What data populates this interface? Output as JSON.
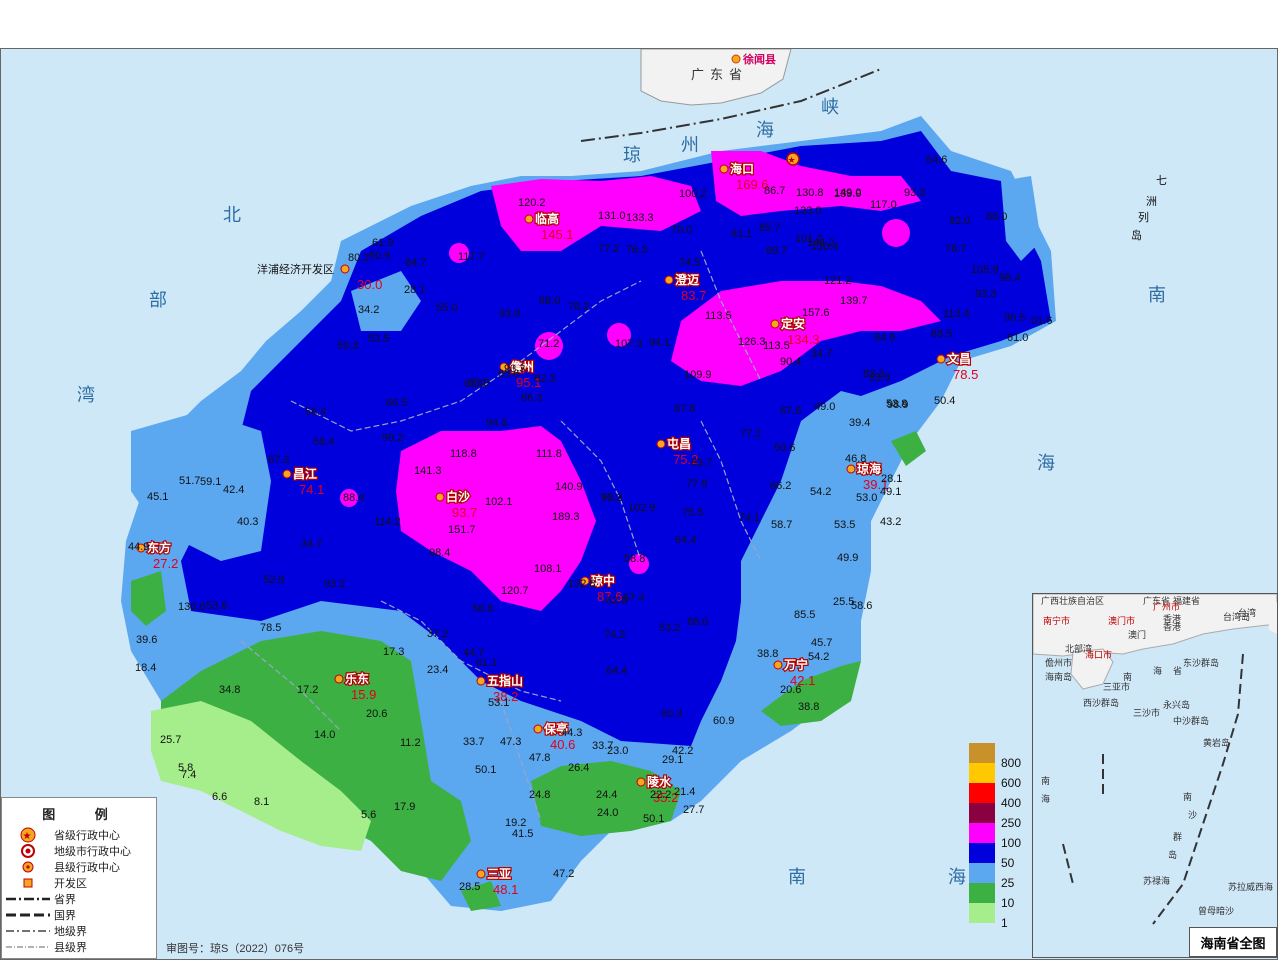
{
  "regions": [
    {
      "name": "广东省"
    },
    {
      "name": "徐闻县"
    }
  ],
  "sea_labels": [
    "琼",
    "州",
    "海",
    "峡",
    "北",
    "部",
    "湾",
    "南",
    "海",
    "七",
    "洲",
    "列",
    "岛",
    "南",
    "海"
  ],
  "cities": [
    {
      "name": "海口",
      "value": "169.6"
    },
    {
      "name": "临高",
      "value": "145.1"
    },
    {
      "name": "澄迈",
      "value": "83.7"
    },
    {
      "name": "定安",
      "value": "134.3"
    },
    {
      "name": "文昌",
      "value": "78.5"
    },
    {
      "name": "儋州",
      "value": "95.1"
    },
    {
      "name": "屯昌",
      "value": "75.2"
    },
    {
      "name": "琼海",
      "value": "39.1"
    },
    {
      "name": "昌江",
      "value": "74.1"
    },
    {
      "name": "白沙",
      "value": "93.7"
    },
    {
      "name": "东方",
      "value": "27.2"
    },
    {
      "name": "琼中",
      "value": "87.6"
    },
    {
      "name": "万宁",
      "value": "42.1"
    },
    {
      "name": "乐东",
      "value": "15.9"
    },
    {
      "name": "五指山",
      "value": "38.2"
    },
    {
      "name": "保亭",
      "value": "40.6"
    },
    {
      "name": "陵水",
      "value": "35.2"
    },
    {
      "name": "三亚",
      "value": "48.1"
    },
    {
      "name": "洋浦经济开发区",
      "value": "30.0"
    }
  ],
  "stations": [
    "93.3",
    "64.6",
    "82.0",
    "66.0",
    "76.7",
    "105.9",
    "98.4",
    "93.3",
    "90.5",
    "01.6",
    "61.0",
    "113.4",
    "88.5",
    "98.9",
    "63.9",
    "84.9",
    "139.7",
    "157.6",
    "113.5",
    "126.3",
    "113.5",
    "90.4",
    "34.7",
    "83.3",
    "53.8",
    "50.4",
    "49.0",
    "39.4",
    "67.6",
    "77.2",
    "50.6",
    "46.8",
    "28.1",
    "53.0",
    "49.1",
    "54.2",
    "53.5",
    "43.2",
    "49.9",
    "58.7",
    "74.1",
    "66.2",
    "75.5",
    "102.9",
    "77.9",
    "83.7",
    "87.8",
    "94.1",
    "107.3",
    "109.9",
    "189.3",
    "140.9",
    "108.1",
    "132.8",
    "120.7",
    "98.4",
    "151.7",
    "102.1",
    "141.3",
    "118.8",
    "111.8",
    "94.6",
    "93.3",
    "86.3",
    "82.3",
    "93.9",
    "66.5",
    "99.2",
    "56.4",
    "58.4",
    "67.3",
    "59.3",
    "53.5",
    "61.9",
    "55.0",
    "34.2",
    "84.7",
    "90.9",
    "28.1",
    "80.2",
    "117.7",
    "120.2",
    "131.0",
    "133.3",
    "77.2",
    "76.3",
    "70.0",
    "81.1",
    "89.7",
    "85.7",
    "86.7",
    "101.2",
    "130.4",
    "133.0",
    "130.8",
    "139.9",
    "149.0",
    "117.0",
    "100.2",
    "144.2",
    "121.2",
    "71.2",
    "88.0",
    "78.2",
    "74.5",
    "93.9",
    "62.0",
    "65.6",
    "52.8",
    "51.7",
    "59.1",
    "42.4",
    "45.1",
    "44.9",
    "40.3",
    "34.7",
    "93.2",
    "88.4",
    "114.2",
    "136.6",
    "53.6",
    "78.5",
    "39.6",
    "18.4",
    "34.8",
    "17.2",
    "20.6",
    "14.0",
    "11.2",
    "25.7",
    "5.8",
    "7.4",
    "6.6",
    "8.1",
    "5.6",
    "17.9",
    "17.3",
    "23.4",
    "37.2",
    "44.7",
    "61.1",
    "53.1",
    "33.7",
    "47.3",
    "50.1",
    "44.3",
    "47.8",
    "33.7",
    "23.0",
    "26.4",
    "24.8",
    "24.4",
    "24.0",
    "19.2",
    "41.5",
    "28.5",
    "47.2",
    "50.1",
    "27.7",
    "22.2",
    "21.4",
    "29.1",
    "42.2",
    "60.9",
    "38.8",
    "20.6",
    "45.7",
    "54.2",
    "38.8",
    "85.5",
    "58.6",
    "25.5",
    "64.4",
    "74.3",
    "58.8",
    "53.2",
    "88.6",
    "62.0",
    "67.4",
    "60.3",
    "58.8",
    "64.4",
    "90.3",
    "77.2"
  ],
  "legend": {
    "title": "图 例",
    "items": [
      {
        "label": "省级行政中心"
      },
      {
        "label": "地级市行政中心"
      },
      {
        "label": "县级行政中心"
      },
      {
        "label": "开发区"
      },
      {
        "label": "省界"
      },
      {
        "label": "国界"
      },
      {
        "label": "地级界"
      },
      {
        "label": "县级界"
      }
    ]
  },
  "scale": [
    {
      "color": "#c8912a",
      "label": "800"
    },
    {
      "color": "#ffc800",
      "label": "600"
    },
    {
      "color": "#ff0000",
      "label": "400"
    },
    {
      "color": "#8b0040",
      "label": "250"
    },
    {
      "color": "#ff00ff",
      "label": "100"
    },
    {
      "color": "#0000dd",
      "label": "50"
    },
    {
      "color": "#5ba8f0",
      "label": "25"
    },
    {
      "color": "#3cb043",
      "label": "10"
    },
    {
      "color": "#a6ee8c",
      "label": "1"
    }
  ],
  "approval": "审图号：琼S（2022）076号",
  "inset": {
    "title": "海南省全图",
    "labels": [
      "广西壮族自治区",
      "广东省",
      "福建省",
      "台湾",
      "南宁市",
      "广州市",
      "澳门市",
      "香港",
      "澳门",
      "香港",
      "台湾岛",
      "北部湾",
      "海口市",
      "儋州市",
      "海南岛",
      "三亚市",
      "南",
      "海",
      "省",
      "东沙群岛",
      "西沙群岛",
      "永兴岛",
      "三沙市",
      "中沙群岛",
      "黄岩岛",
      "南",
      "海",
      "南",
      "沙",
      "群",
      "岛",
      "苏禄海",
      "苏拉威西海",
      "曾母暗沙"
    ]
  }
}
